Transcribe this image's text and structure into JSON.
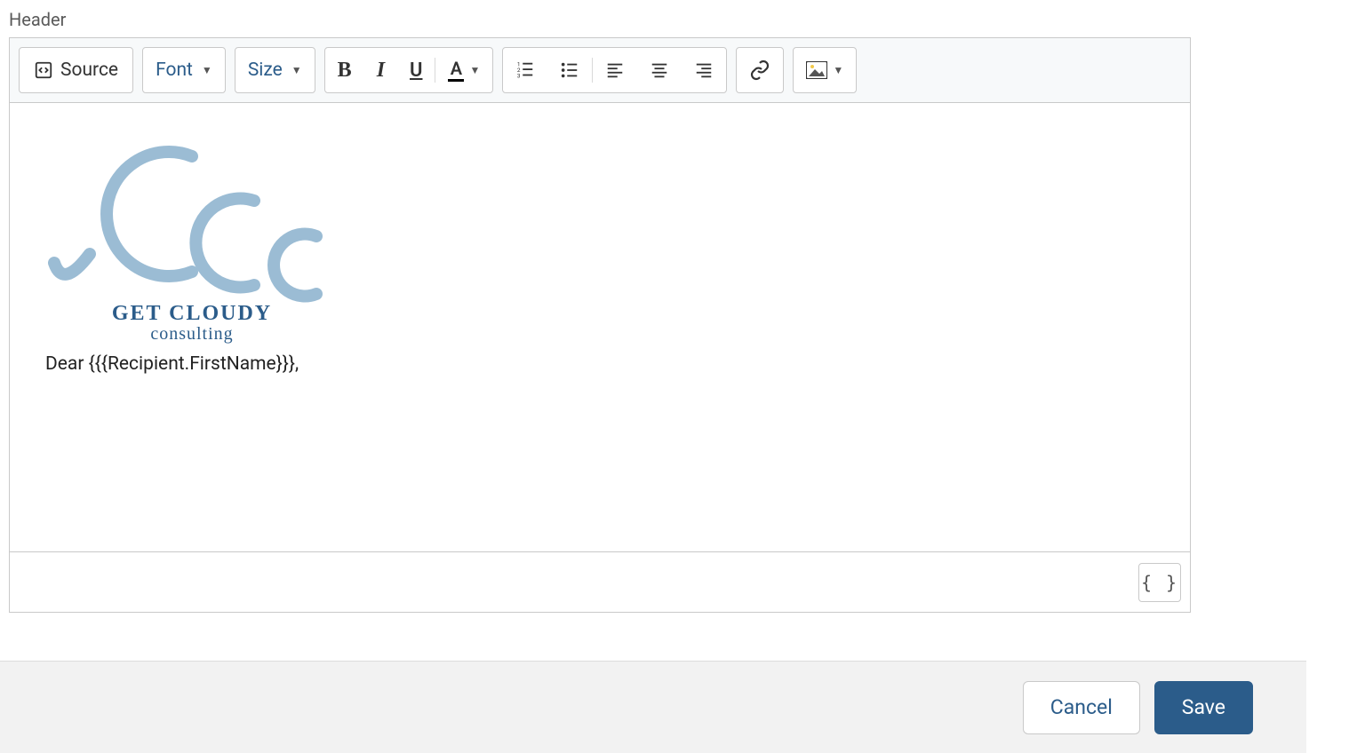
{
  "label": "Header",
  "toolbar": {
    "source_label": "Source",
    "font_label": "Font",
    "size_label": "Size"
  },
  "content": {
    "logo_title": "GET CLOUDY",
    "logo_sub": "consulting",
    "body_line": "Dear {{{Recipient.FirstName}}},"
  },
  "merge_field_button": "{ }",
  "buttons": {
    "cancel": "Cancel",
    "save": "Save"
  }
}
